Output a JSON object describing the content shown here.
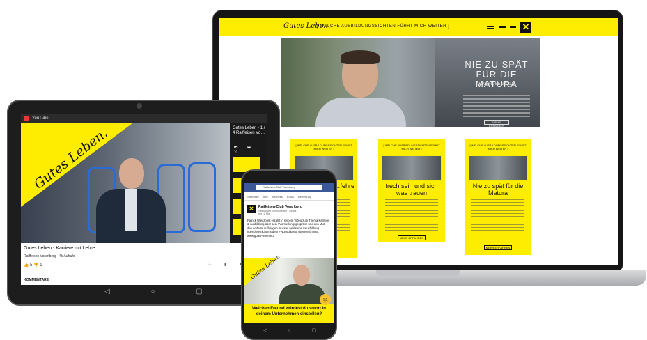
{
  "laptop": {
    "logo": "Gutes Leben.",
    "tagline": "[ WELCHE AUSBILDUNGSSICHTEN FÜHRT MICH WEITER ]",
    "brand_mark": "✕",
    "hero": {
      "title": "NIE ZU SPÄT FÜR DIE MATURA",
      "subtitle": "RAIFFEISEN CLUB",
      "button": "MEHR ERFAHREN"
    },
    "cards": [
      {
        "kicker": "[ WELCHE AUSBILDUNGSSICHTEN FÜHRT MICH WEITER ]",
        "title": "…fehre",
        "button": "MEHR ERFAHREN"
      },
      {
        "kicker": "[ WELCHE AUSBILDUNGSSICHTEN FÜHRT MICH WEITER ]",
        "title": "frech sein und sich was trauen",
        "button": "MEHR ERFAHREN"
      },
      {
        "kicker": "[ WELCHE AUSBILDUNGSSICHTEN FÜHRT MICH WEITER ]",
        "title": "Nie zu spät für die Matura",
        "button": "MEHR ERFAHREN"
      }
    ]
  },
  "tablet": {
    "app": "YouTube",
    "banner": "Gutes Leben.",
    "side_title": "Gutes Leben - 1 / 4 Raiffeisen Vo…",
    "side_controls": "⏮ ⏭ ⤮",
    "video_title": "Gutes Leben - Karriere mit Lehre",
    "channel": "Raiffeisen Vorarlberg · 4k Aufrufe",
    "likes": "👍 5   👎 1",
    "actions": "↪ ⬇ ⚑",
    "comments": "KOMMENTARE",
    "nav": "◁ ○ ▢"
  },
  "phone": {
    "search": "Raiffeisen-Club Vorarlberg",
    "tabs": [
      "Startseite",
      "Info",
      "Services",
      "Fotos",
      "Bewertung"
    ],
    "page_name": "Raiffeisen-Club Vorarlberg",
    "meta": "Gesponsert von Raiffeisen · Gefällt mir 12 Std.",
    "post": "Patrick Wieczorek erzählt in seinem Video zum Thema Karriere & Ausbildung über sein #Vorstellungsgespräch und den Mut, den er dafür aufbringen musste, weil seine #Ausbildung irgendwie nicht mit dem #Wunschberuf übereinstimmte. www.gutes-leben.eu",
    "banner": "Gutes Leben.",
    "caption": "Welchen Freund würdest du sofort in deinem Unternehmen einstellen?",
    "emoji": "😊",
    "nav": "◁ ○ ▢"
  }
}
